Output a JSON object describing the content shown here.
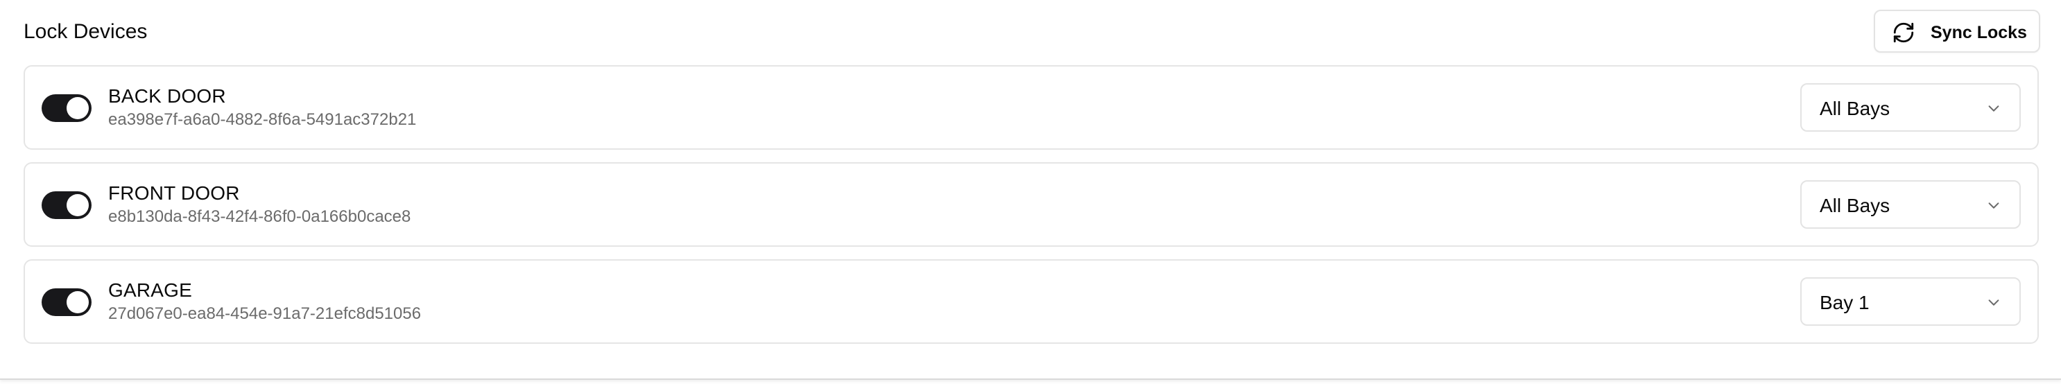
{
  "header": {
    "title": "Lock Devices",
    "sync_label": "Sync Locks"
  },
  "devices": [
    {
      "name": "BACK DOOR",
      "id": "ea398e7f-a6a0-4882-8f6a-5491ac372b21",
      "enabled": true,
      "bay": "All Bays"
    },
    {
      "name": "FRONT DOOR",
      "id": "e8b130da-8f43-42f4-86f0-0a166b0cace8",
      "enabled": true,
      "bay": "All Bays"
    },
    {
      "name": "GARAGE",
      "id": "27d067e0-ea84-454e-91a7-21efc8d51056",
      "enabled": true,
      "bay": "Bay 1"
    }
  ],
  "colors": {
    "toggle_on": "#18181b",
    "border": "#e5e5e5",
    "muted_text": "#6b6b6b"
  },
  "icons": {
    "sync": "refresh-icon",
    "select": "chevron-down-icon"
  }
}
